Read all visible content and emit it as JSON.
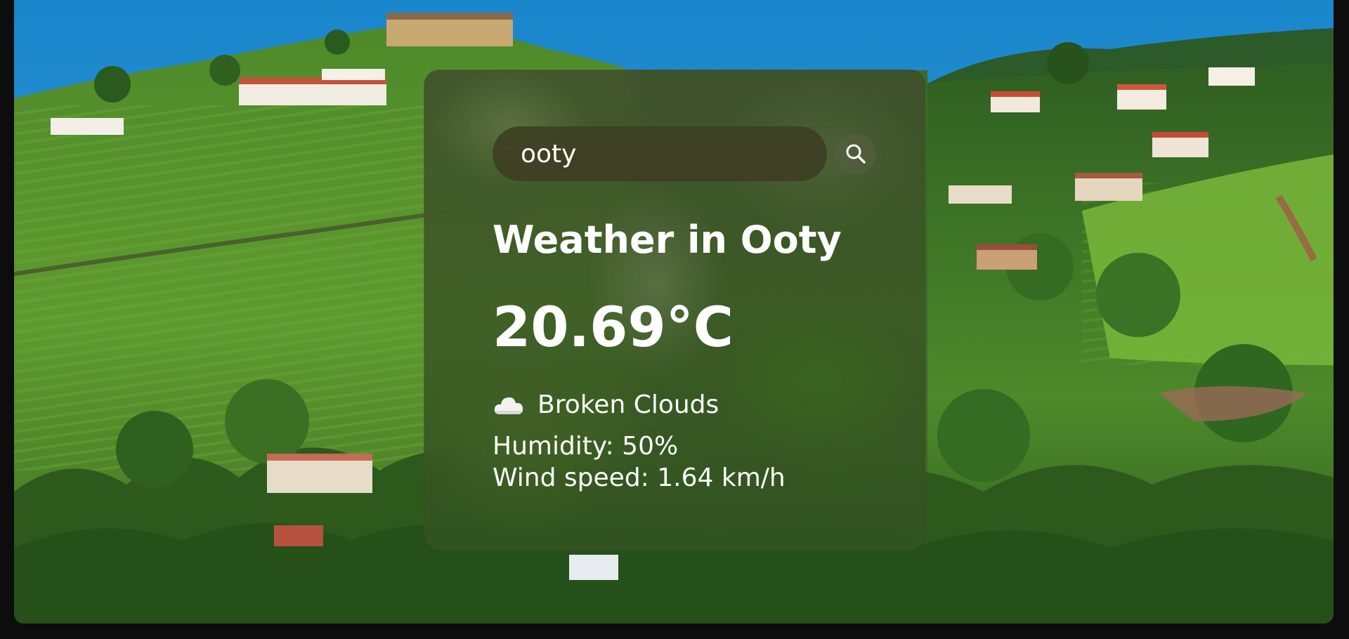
{
  "search": {
    "value": "ooty",
    "button_icon": "search-icon"
  },
  "weather": {
    "title": "Weather in Ooty",
    "temperature": "20.69°C",
    "condition_icon": "cloud-icon",
    "description": "Broken Clouds",
    "humidity": "Humidity: 50%",
    "wind_speed": "Wind speed: 1.64 km/h"
  },
  "colors": {
    "sky": "#1c88cc",
    "panel": "#3e3e22",
    "text": "#ffffff"
  }
}
